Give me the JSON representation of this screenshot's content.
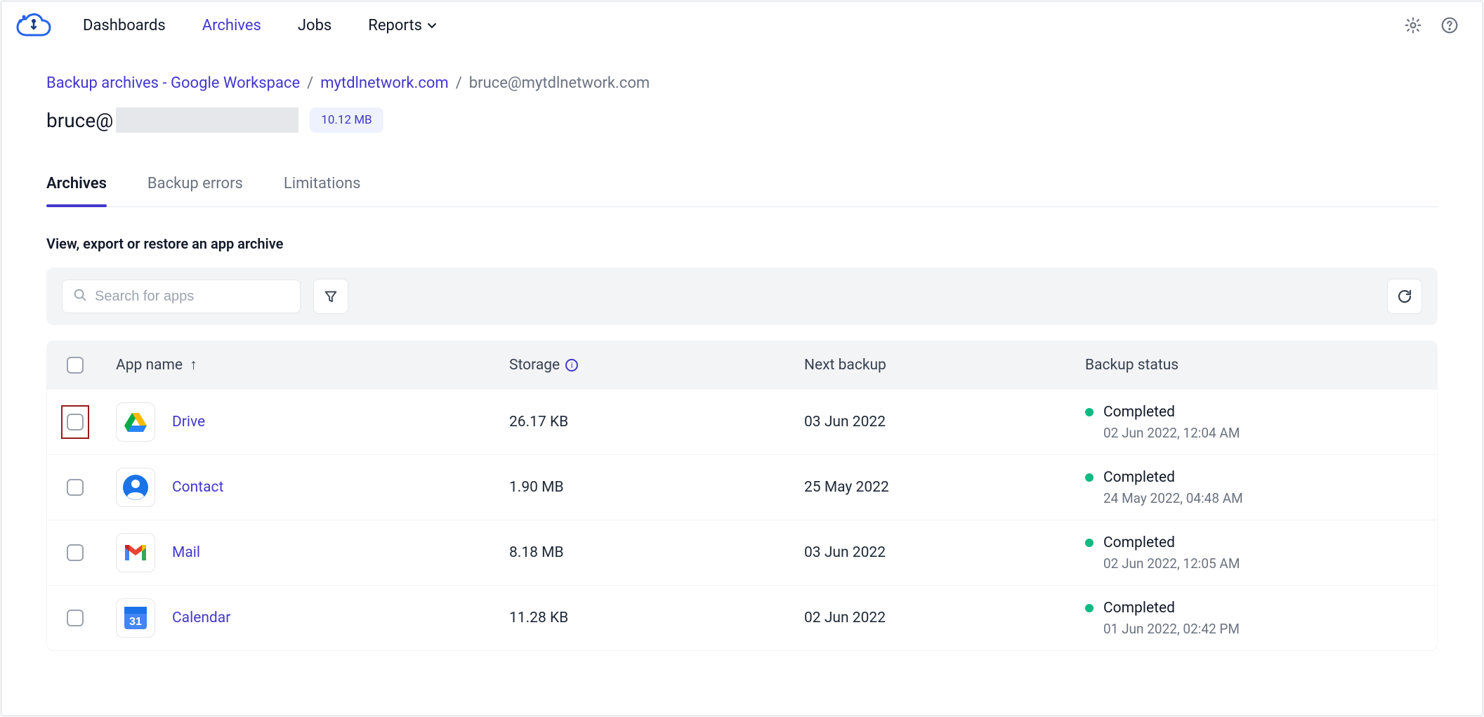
{
  "nav": {
    "items": [
      "Dashboards",
      "Archives",
      "Jobs",
      "Reports"
    ],
    "active_index": 1
  },
  "breadcrumb": {
    "root": "Backup archives - Google Workspace",
    "domain": "mytdlnetwork.com",
    "current": "bruce@mytdlnetwork.com"
  },
  "page": {
    "title_prefix": "bruce@",
    "size_badge": "10.12 MB"
  },
  "tabs": {
    "items": [
      "Archives",
      "Backup errors",
      "Limitations"
    ],
    "active_index": 0
  },
  "section_subtitle": "View, export or restore an app archive",
  "search": {
    "placeholder": "Search for apps"
  },
  "table": {
    "headers": {
      "app": "App name",
      "storage": "Storage",
      "next": "Next backup",
      "status": "Backup status"
    },
    "rows": [
      {
        "icon": "drive",
        "app": "Drive",
        "storage": "26.17 KB",
        "next": "03 Jun 2022",
        "status": "Completed",
        "status_sub": "02 Jun 2022, 12:04 AM",
        "highlight_checkbox": true
      },
      {
        "icon": "contact",
        "app": "Contact",
        "storage": "1.90 MB",
        "next": "25 May 2022",
        "status": "Completed",
        "status_sub": "24 May 2022, 04:48 AM"
      },
      {
        "icon": "mail",
        "app": "Mail",
        "storage": "8.18 MB",
        "next": "03 Jun 2022",
        "status": "Completed",
        "status_sub": "02 Jun 2022, 12:05 AM"
      },
      {
        "icon": "calendar",
        "app": "Calendar",
        "storage": "11.28 KB",
        "next": "02 Jun 2022",
        "status": "Completed",
        "status_sub": "01 Jun 2022, 02:42 PM"
      }
    ]
  },
  "icons": {
    "calendar_day": "31"
  }
}
